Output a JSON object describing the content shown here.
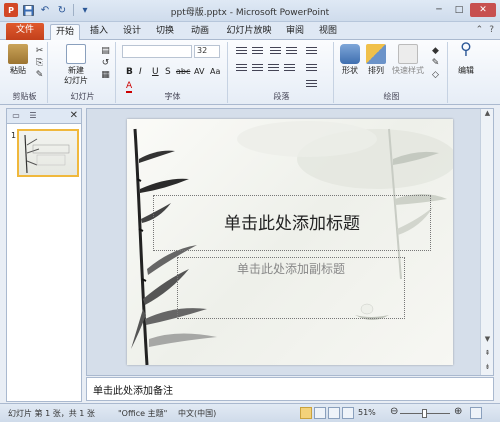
{
  "window": {
    "title": "ppt母版.pptx - Microsoft PowerPoint",
    "app_icon_letter": "P"
  },
  "tabs": {
    "file": "文件",
    "items": [
      "开始",
      "插入",
      "设计",
      "切换",
      "动画",
      "幻灯片放映",
      "审阅",
      "视图"
    ],
    "active_index": 0
  },
  "ribbon": {
    "clipboard": {
      "paste": "粘贴",
      "group_label": "剪贴板"
    },
    "slides": {
      "new_slide_line1": "新建",
      "new_slide_line2": "幻灯片",
      "group_label": "幻灯片"
    },
    "font": {
      "size": "32",
      "group_label": "字体",
      "format_labels": [
        "B",
        "I",
        "U",
        "S",
        "abc",
        "AV",
        "Aa",
        "A"
      ]
    },
    "paragraph": {
      "group_label": "段落"
    },
    "drawing": {
      "shape": "形状",
      "arrange": "排列",
      "quick_styles": "快速样式",
      "group_label": "绘图"
    },
    "editing": {
      "label": "编辑"
    }
  },
  "thumbnail": {
    "number": "1"
  },
  "slide": {
    "title_placeholder": "单击此处添加标题",
    "subtitle_placeholder": "单击此处添加副标题"
  },
  "notes": {
    "placeholder": "单击此处添加备注"
  },
  "status": {
    "slide_info": "幻灯片 第 1 张，共 1 张",
    "theme": "\"Office 主题\"",
    "language": "中文(中国)",
    "zoom": "51%"
  },
  "colors": {
    "file_tab": "#d24726",
    "thumb_border": "#f0b83c",
    "ribbon_bg": "#f6f9fd"
  }
}
